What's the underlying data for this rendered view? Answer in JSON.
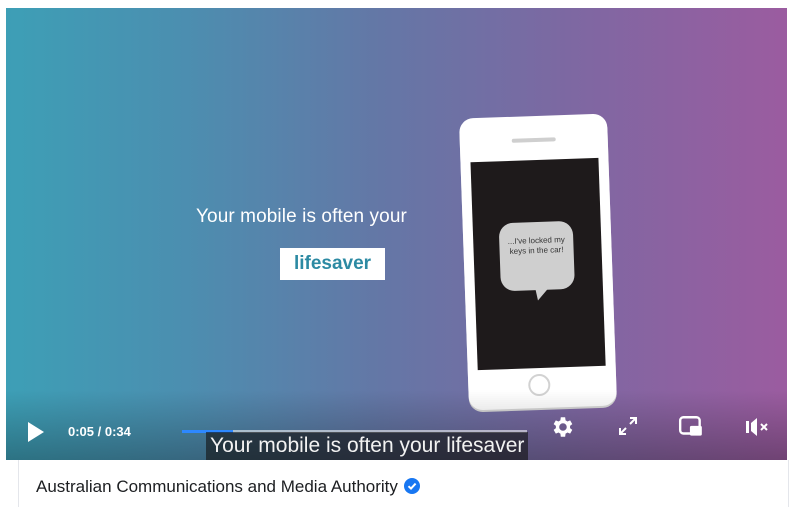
{
  "video": {
    "headline": "Your mobile is often your",
    "highlight_word": "lifesaver",
    "speech_bubble_text": "...I've locked my keys in the car!",
    "caption": "Your mobile is often your lifesaver",
    "colors": {
      "gradient_left": "#3d9fb6",
      "gradient_right": "#9b5ca0",
      "highlight_text": "#2c8aa3",
      "progress": "#2d88ff"
    }
  },
  "player": {
    "time_display": "0:05 / 0:34",
    "progress_fraction": 0.147,
    "icons": [
      "play-icon",
      "settings-gear-icon",
      "fullscreen-icon",
      "picture-in-picture-icon",
      "muted-volume-icon"
    ]
  },
  "page": {
    "channel_name": "Australian Communications and Media Authority",
    "verified": true
  }
}
